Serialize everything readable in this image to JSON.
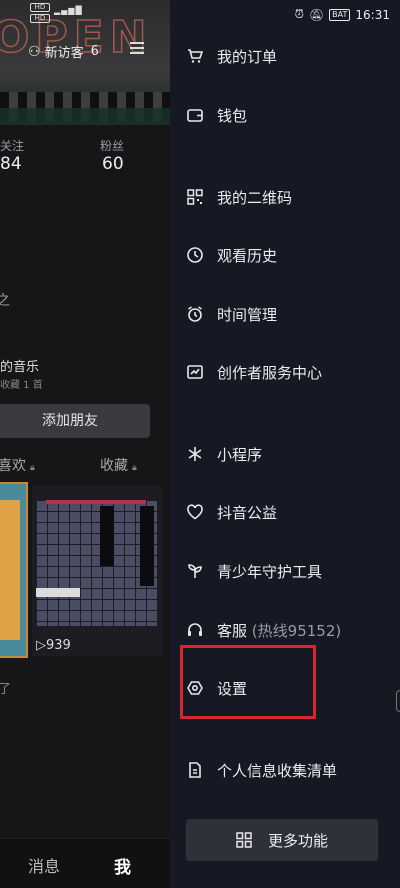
{
  "status_bar": {
    "left_sims": [
      "HD 5G",
      "HD 5G"
    ],
    "signal": "all",
    "time": "16:31",
    "battery": "BAT"
  },
  "profile": {
    "visitors_label": "新访客",
    "visitors_count": "6",
    "following_label": "关注",
    "following_value": "84",
    "fans_label": "粉丝",
    "fans_value": "60",
    "bio_fragment": "之",
    "music_title": "的音乐",
    "music_sub": "收藏 1 首",
    "add_friend": "添加朋友",
    "tab_likes": "喜欢",
    "tab_favorites": "收藏",
    "play_count": "939",
    "footer_fragment": "了"
  },
  "bottom_nav": {
    "messages": "消息",
    "me": "我"
  },
  "drawer": {
    "items": [
      {
        "icon": "cart-icon",
        "label": "我的订单"
      },
      {
        "icon": "wallet-icon",
        "label": "钱包"
      },
      {
        "icon": "qr-code-icon",
        "label": "我的二维码"
      },
      {
        "icon": "clock-icon",
        "label": "观看历史"
      },
      {
        "icon": "alarm-icon",
        "label": "时间管理"
      },
      {
        "icon": "chart-icon",
        "label": "创作者服务中心"
      },
      {
        "icon": "asterisk-icon",
        "label": "小程序"
      },
      {
        "icon": "heart-icon",
        "label": "抖音公益"
      },
      {
        "icon": "sprout-icon",
        "label": "青少年守护工具"
      },
      {
        "icon": "headset-icon",
        "label": "客服",
        "extra": "(热线95152)"
      },
      {
        "icon": "gear-icon",
        "label": "设置"
      },
      {
        "icon": "document-icon",
        "label": "个人信息收集清单"
      }
    ],
    "more_button": "更多功能"
  }
}
